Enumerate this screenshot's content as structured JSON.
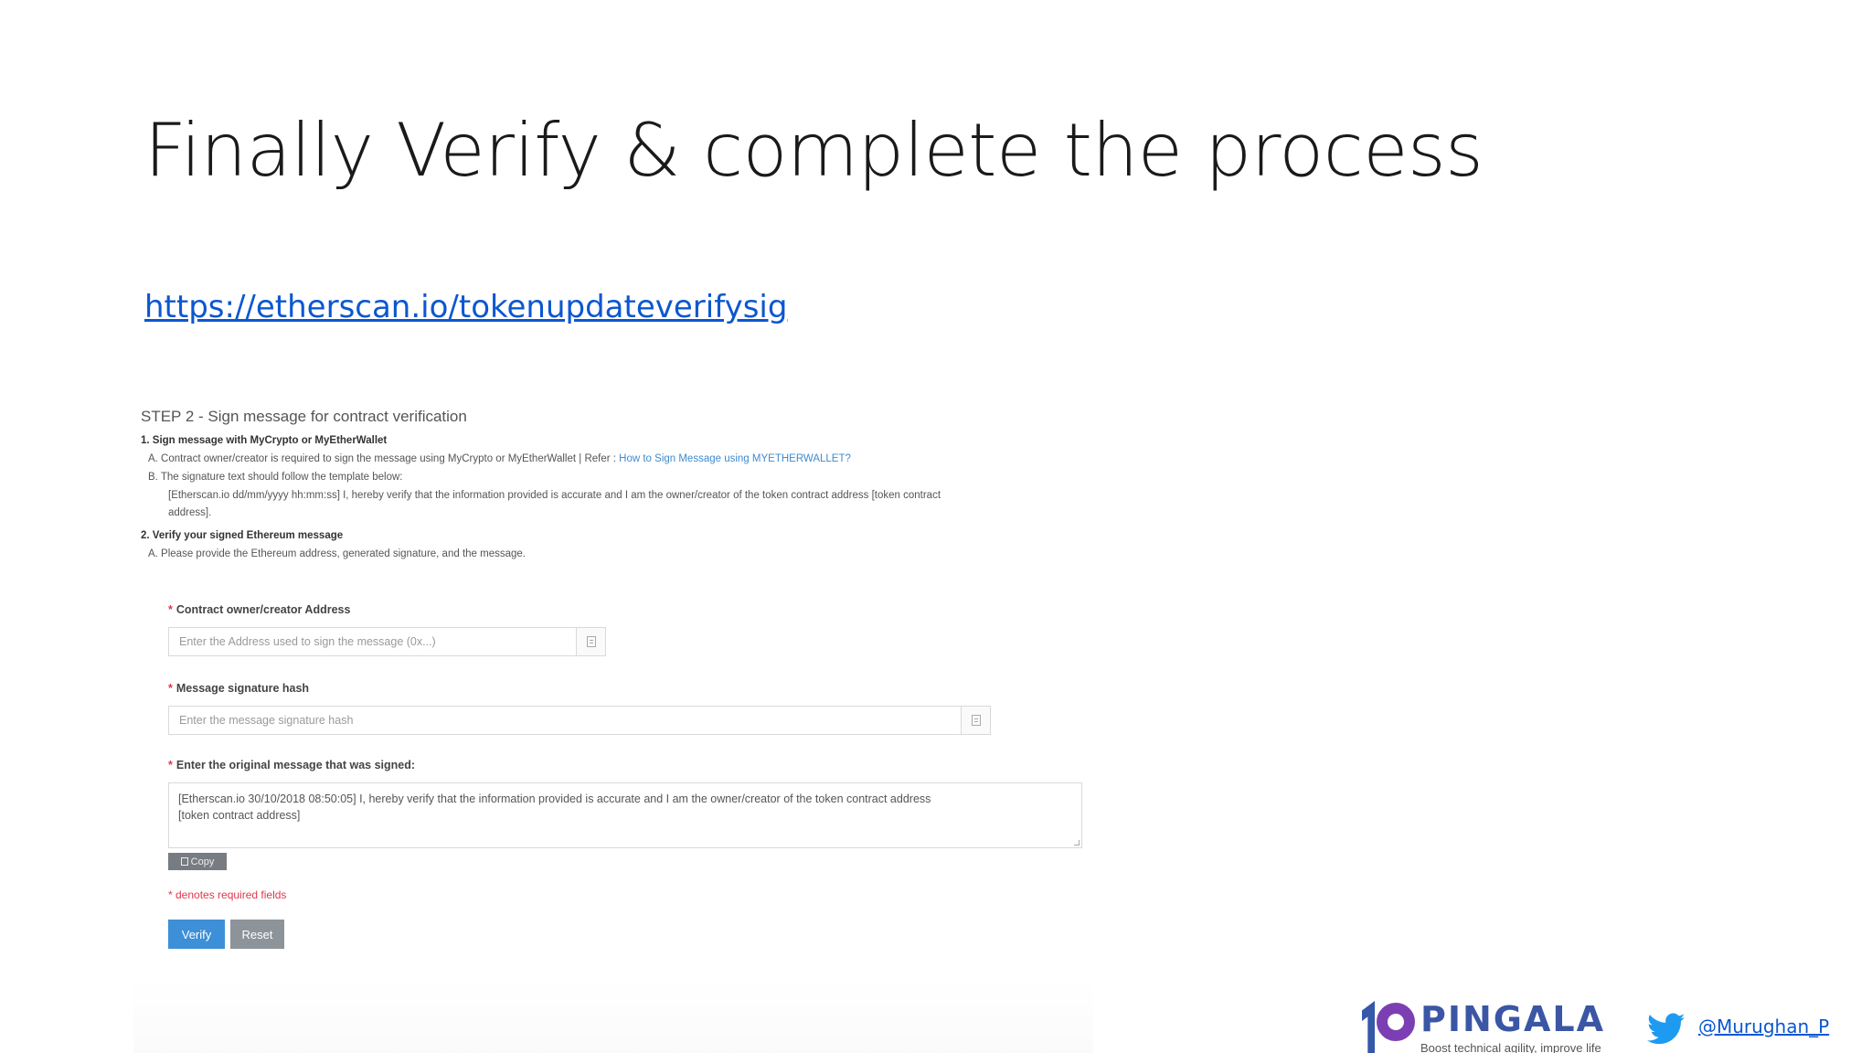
{
  "slide": {
    "title": "Finally Verify & complete the process",
    "link": "https://etherscan.io/tokenupdateverifysig"
  },
  "form": {
    "step_heading": "STEP 2 - Sign message for contract verification",
    "instructions": {
      "item1_title": "1.  Sign message with MyCrypto or MyEtherWallet",
      "item1a_text": "A.  Contract owner/creator is required to sign the message using MyCrypto or MyEtherWallet | Refer : ",
      "item1a_link": "How to Sign Message using MYETHERWALLET?",
      "item1b_line1": "B.  The signature text should follow the template below:",
      "item1b_line2": "[Etherscan.io dd/mm/yyyy hh:mm:ss] I, hereby verify that the information provided is accurate and I am the owner/creator of the token contract address [token contract",
      "item1b_line3": "address].",
      "item2_title": "2.  Verify your signed Ethereum message",
      "item2a_text": "A.  Please provide the Ethereum address, generated signature, and the message."
    },
    "address_label": "Contract owner/creator Address",
    "address_placeholder": "Enter the Address used to sign the message (0x...)",
    "signature_label": "Message signature hash",
    "signature_placeholder": "Enter the message signature hash",
    "message_label": "Enter the original message that was signed:",
    "message_line1": "[Etherscan.io 30/10/2018 08:50:05] I, hereby verify that the information provided is accurate and I am the owner/creator of the token contract address",
    "message_line2": "[token contract address]",
    "copy_label": "Copy",
    "required_star": "*",
    "required_note": "* denotes required fields",
    "verify_label": "Verify",
    "reset_label": "Reset"
  },
  "footer": {
    "logo_word": "PINGALA",
    "logo_tagline": "Boost technical agility, improve life",
    "twitter_handle": "@Murughan_P"
  },
  "colors": {
    "link": "#0b57d0",
    "verify_button": "#3d8fd8",
    "reset_button": "#8c9399",
    "required": "#e0384b",
    "logo_blue": "#3a56a5",
    "logo_purple": "#7c3fb3",
    "twitter": "#1d9bf0"
  },
  "icons": [
    "paste-icon",
    "copy-icon",
    "twitter-icon",
    "pingala-logo"
  ]
}
